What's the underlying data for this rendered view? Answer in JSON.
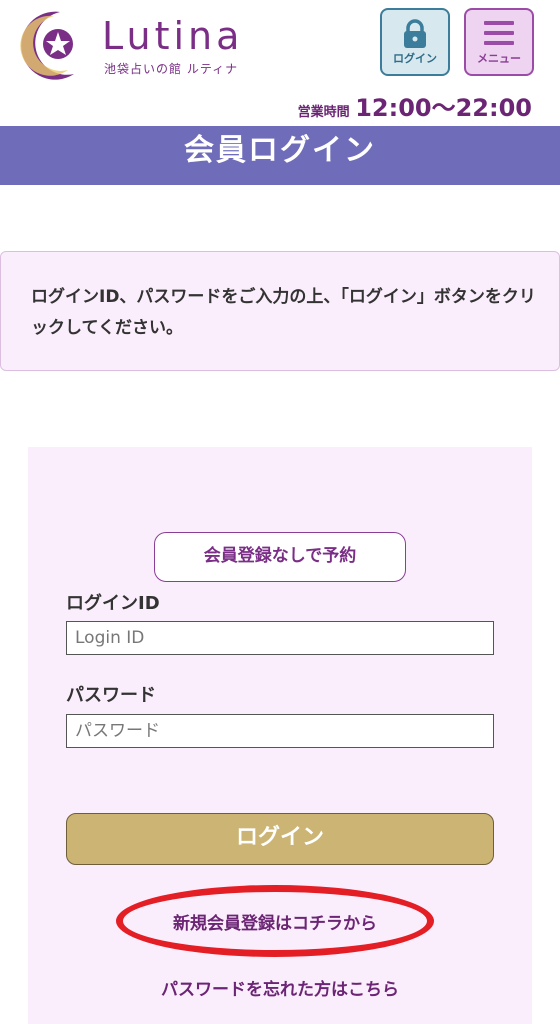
{
  "header": {
    "brand_name": "Lutina",
    "brand_sub": "池袋占いの館 ルティナ",
    "login_button_label": "ログイン",
    "menu_button_label": "メニュー",
    "hours_label": "営業時間",
    "hours_time": "12:00〜22:00"
  },
  "page_title": "会員ログイン",
  "notice_text": "ログインID、パスワードをご入力の上、「ログイン」ボタンをクリックしてください。",
  "form": {
    "no_member_button": "会員登録なしで予約",
    "login_id_label": "ログインID",
    "login_id_placeholder": "Login ID",
    "login_id_value": "",
    "password_label": "パスワード",
    "password_placeholder": "パスワード",
    "password_value": "",
    "submit_label": "ログイン",
    "register_link": "新規会員登録はコチラから",
    "forgot_link": "パスワードを忘れた方はこちら"
  },
  "colors": {
    "brand_purple": "#7a2e86",
    "title_bar": "#6f6cb9",
    "panel_bg": "#fbeefc",
    "login_gold": "#cbb474",
    "highlight_red": "#e31e24"
  }
}
